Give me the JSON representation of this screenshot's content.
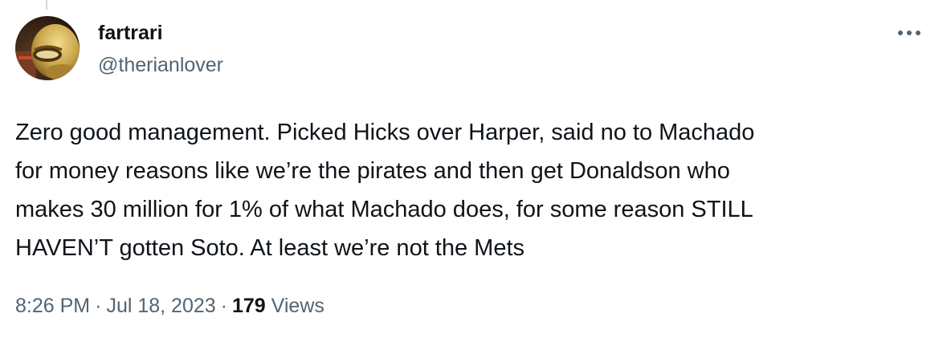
{
  "tweet": {
    "author": {
      "display_name": "fartrari",
      "handle": "@therianlover",
      "avatar_icon": "avatar-cartoon-character-icon"
    },
    "more_icon": "more-options-icon",
    "text": "Zero good management. Picked Hicks over Harper, said no to Machado\nfor money reasons like we’re the pirates and then get Donaldson who\nmakes 30 million for 1% of what Machado does, for some reason STILL\nHAVEN’T gotten Soto. At least we’re not the Mets",
    "time": "8:26 PM",
    "separator": "·",
    "date": "Jul 18, 2023",
    "views_count": "179",
    "views_label": "Views"
  },
  "colors": {
    "primary_text": "#0f1419",
    "secondary_text": "#536471",
    "thread_line": "#cfd9de"
  }
}
